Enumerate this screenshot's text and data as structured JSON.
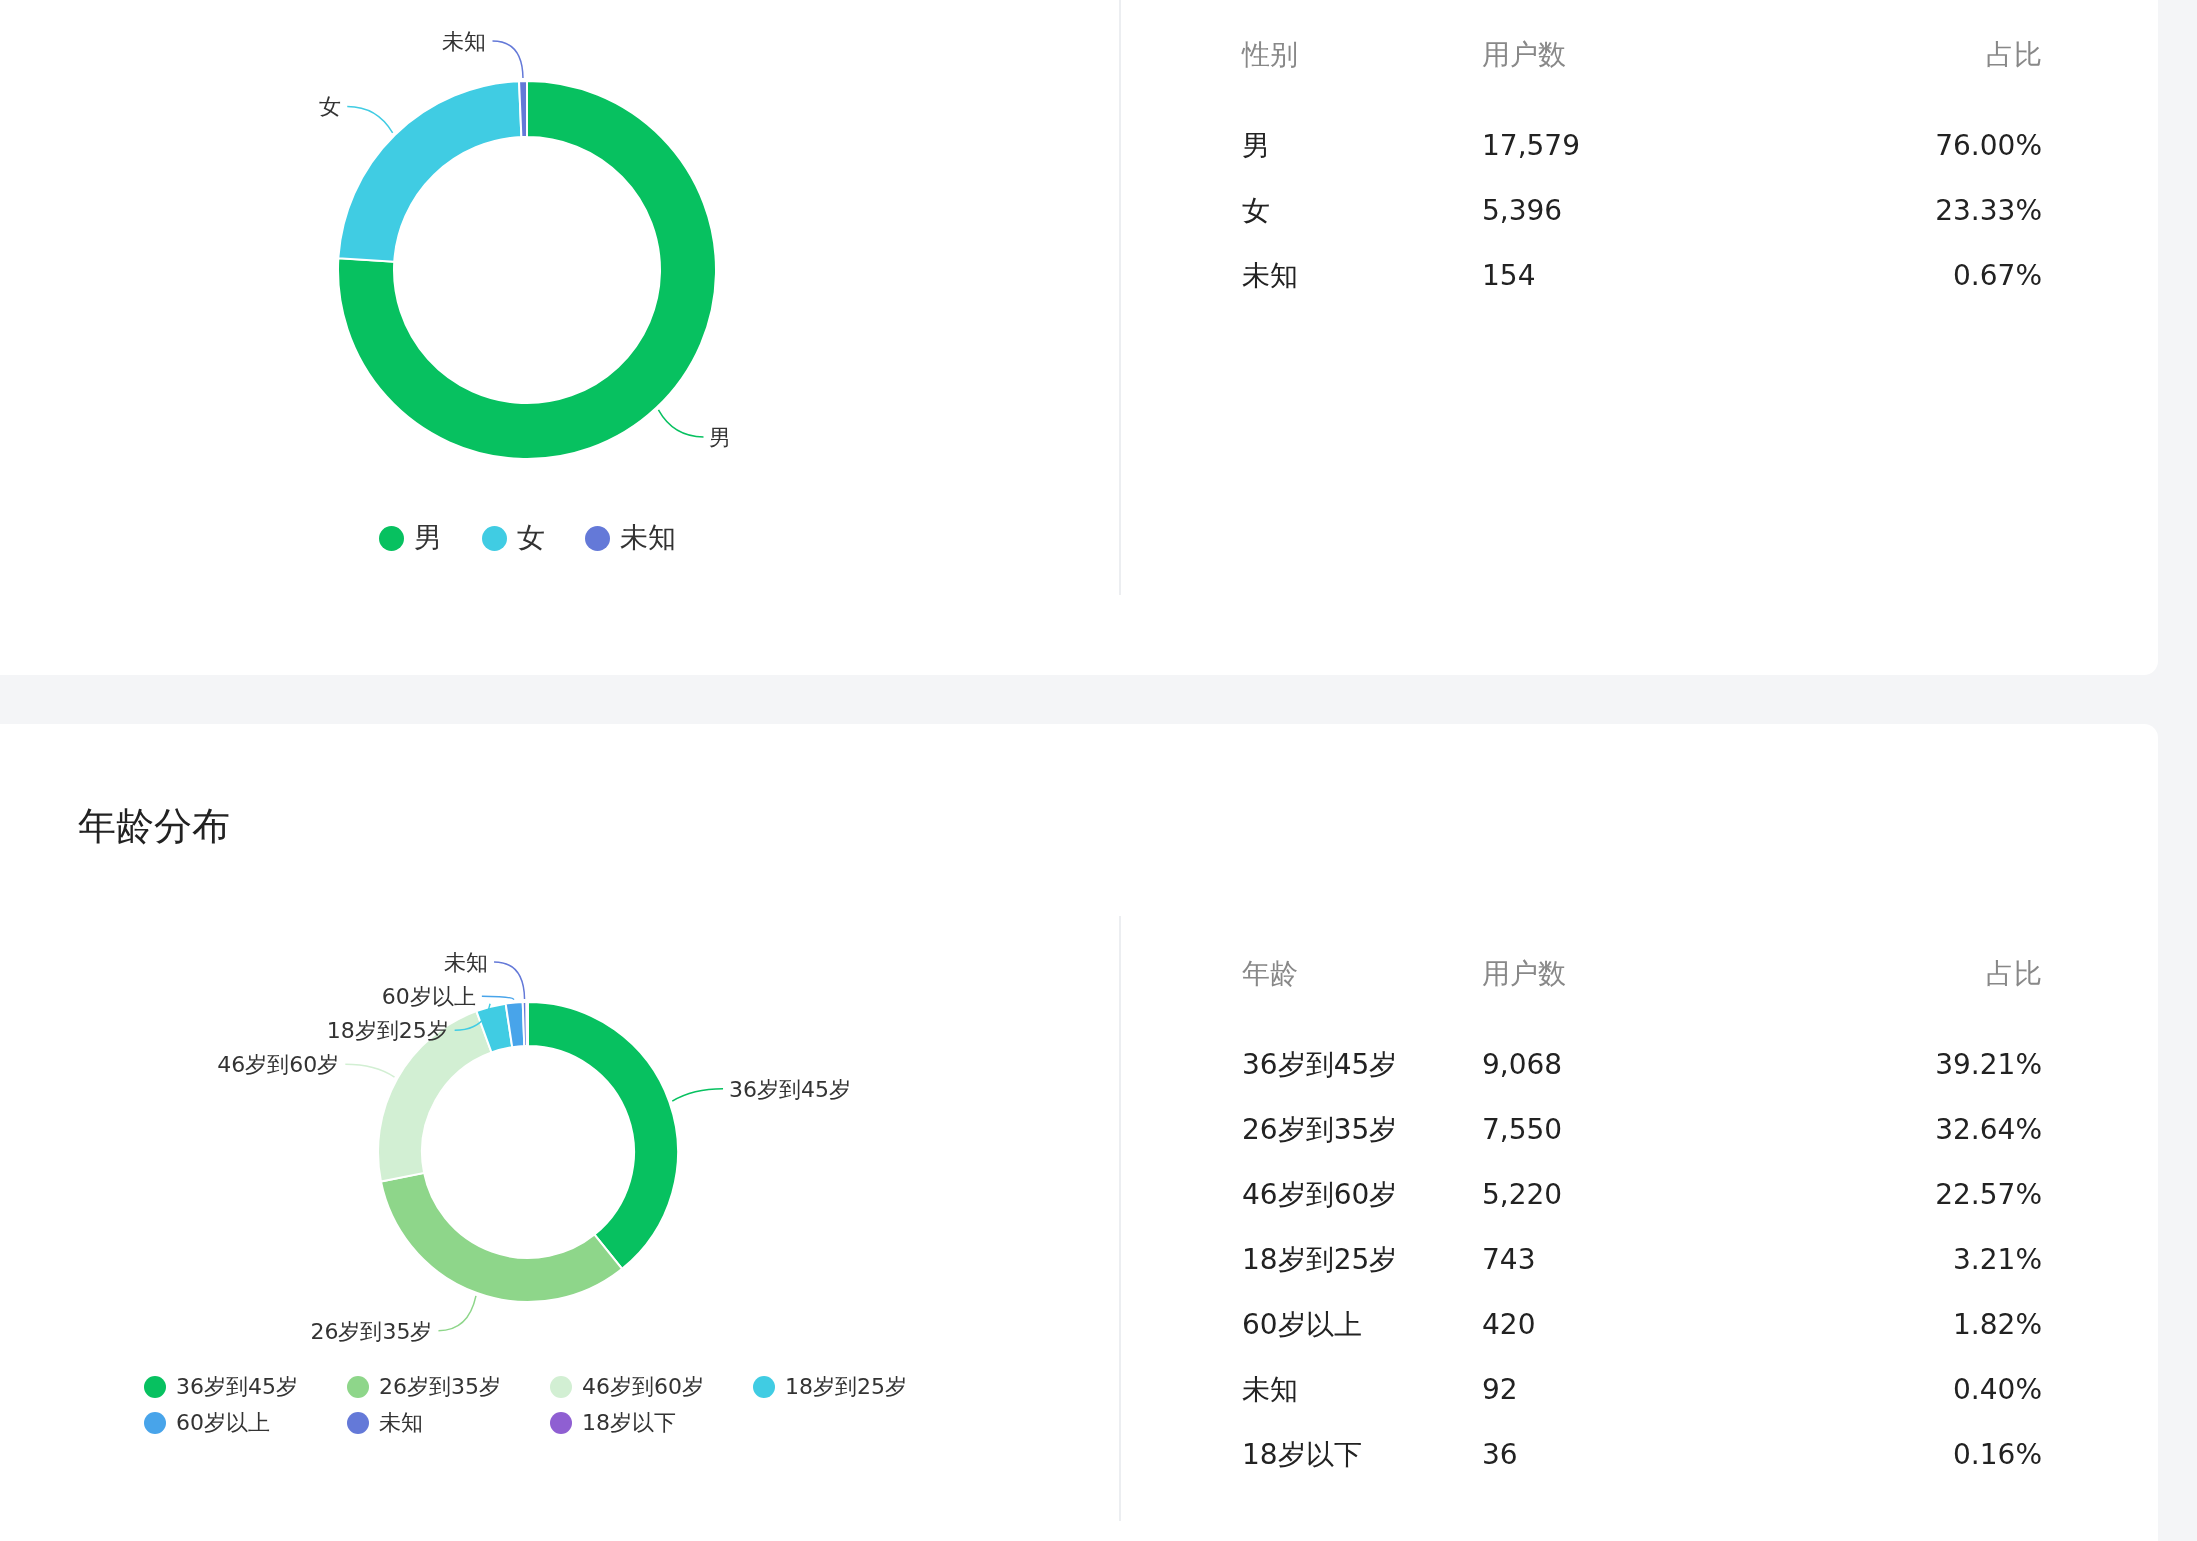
{
  "gender_card": {
    "chart_data": {
      "type": "donut",
      "categories": [
        "男",
        "女",
        "未知"
      ],
      "colors": [
        "#07c160",
        "#40cce3",
        "#6479d8"
      ],
      "legend": "bottom",
      "series": [
        {
          "values": [
            76.0,
            23.33,
            0.67
          ]
        }
      ]
    },
    "table": {
      "columns": [
        "性别",
        "用户数",
        "占比"
      ],
      "rows": [
        [
          "男",
          "17,579",
          "76.00%"
        ],
        [
          "女",
          "5,396",
          "23.33%"
        ],
        [
          "未知",
          "154",
          "0.67%"
        ]
      ]
    }
  },
  "age_card": {
    "title": "年龄分布",
    "chart_data": {
      "type": "donut",
      "categories": [
        "36岁到45岁",
        "26岁到35岁",
        "46岁到60岁",
        "18岁到25岁",
        "60岁以上",
        "未知",
        "18岁以下"
      ],
      "colors": [
        "#07c160",
        "#8ed68a",
        "#d2efd3",
        "#40cce3",
        "#48a4ea",
        "#6479d8",
        "#8f5fd2"
      ],
      "legend": "bottom",
      "series": [
        {
          "values": [
            39.21,
            32.64,
            22.57,
            3.21,
            1.82,
            0.4,
            0.16
          ]
        }
      ]
    },
    "table": {
      "columns": [
        "年龄",
        "用户数",
        "占比"
      ],
      "rows": [
        [
          "36岁到45岁",
          "9,068",
          "39.21%"
        ],
        [
          "26岁到35岁",
          "7,550",
          "32.64%"
        ],
        [
          "46岁到60岁",
          "5,220",
          "22.57%"
        ],
        [
          "18岁到25岁",
          "743",
          "3.21%"
        ],
        [
          "60岁以上",
          "420",
          "1.82%"
        ],
        [
          "未知",
          "92",
          "0.40%"
        ],
        [
          "18岁以下",
          "36",
          "0.16%"
        ]
      ]
    }
  }
}
